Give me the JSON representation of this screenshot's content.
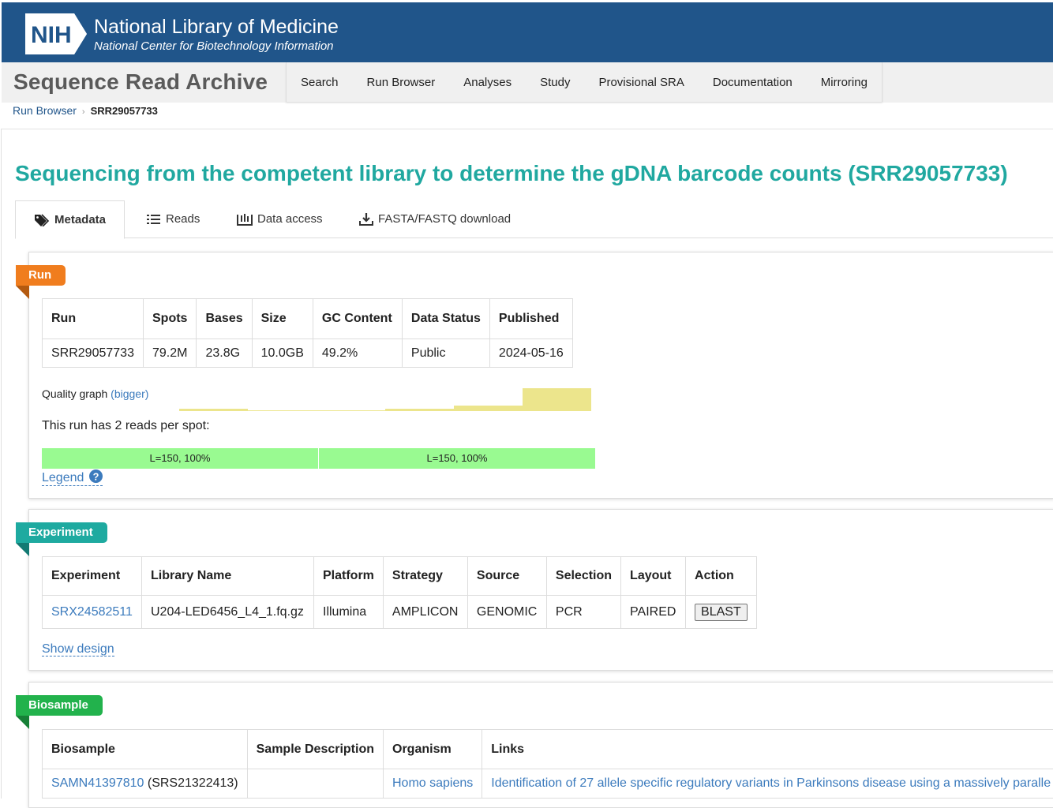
{
  "header": {
    "logo_text": "NIH",
    "title": "National Library of Medicine",
    "subtitle": "National Center for Biotechnology Information"
  },
  "sra": {
    "title": "Sequence Read Archive",
    "nav": [
      "Search",
      "Run Browser",
      "Analyses",
      "Study",
      "Provisional SRA",
      "Documentation",
      "Mirroring"
    ]
  },
  "breadcrumb": {
    "parent": "Run Browser",
    "current": "SRR29057733"
  },
  "page_title": "Sequencing from the competent library to determine the gDNA barcode counts (SRR29057733)",
  "tabs": [
    {
      "label": "Metadata",
      "icon": "tags-icon",
      "active": true
    },
    {
      "label": "Reads",
      "icon": "list-icon"
    },
    {
      "label": "Data access",
      "icon": "inbox-icon"
    },
    {
      "label": "FASTA/FASTQ download",
      "icon": "download-icon"
    }
  ],
  "run": {
    "label": "Run",
    "color": "#f07d1e",
    "headers": [
      "Run",
      "Spots",
      "Bases",
      "Size",
      "GC Content",
      "Data Status",
      "Published"
    ],
    "row": [
      "SRR29057733",
      "79.2M",
      "23.8G",
      "10.0GB",
      "49.2%",
      "Public",
      "2024-05-16"
    ],
    "quality_label": "Quality graph",
    "quality_link": "(bigger)",
    "reads_text": "This run has 2 reads per spot:",
    "reads": [
      "L=150, 100%",
      "L=150, 100%"
    ],
    "legend": "Legend"
  },
  "experiment": {
    "label": "Experiment",
    "color": "#1eaaa0",
    "headers": [
      "Experiment",
      "Library Name",
      "Platform",
      "Strategy",
      "Source",
      "Selection",
      "Layout",
      "Action"
    ],
    "row": [
      "SRX24582511",
      "U204-LED6456_L4_1.fq.gz",
      "Illumina",
      "AMPLICON",
      "GENOMIC",
      "PCR",
      "PAIRED"
    ],
    "action": "BLAST",
    "show_design": "Show design"
  },
  "biosample": {
    "label": "Biosample",
    "color": "#22b24c",
    "headers": [
      "Biosample",
      "Sample Description",
      "Organism",
      "Links"
    ],
    "id": "SAMN41397810",
    "srs": "(SRS21322413)",
    "description": "",
    "organism": "Homo sapiens",
    "link": "Identification of 27 allele specific regulatory variants in Parkinsons disease using a massively paralle"
  }
}
